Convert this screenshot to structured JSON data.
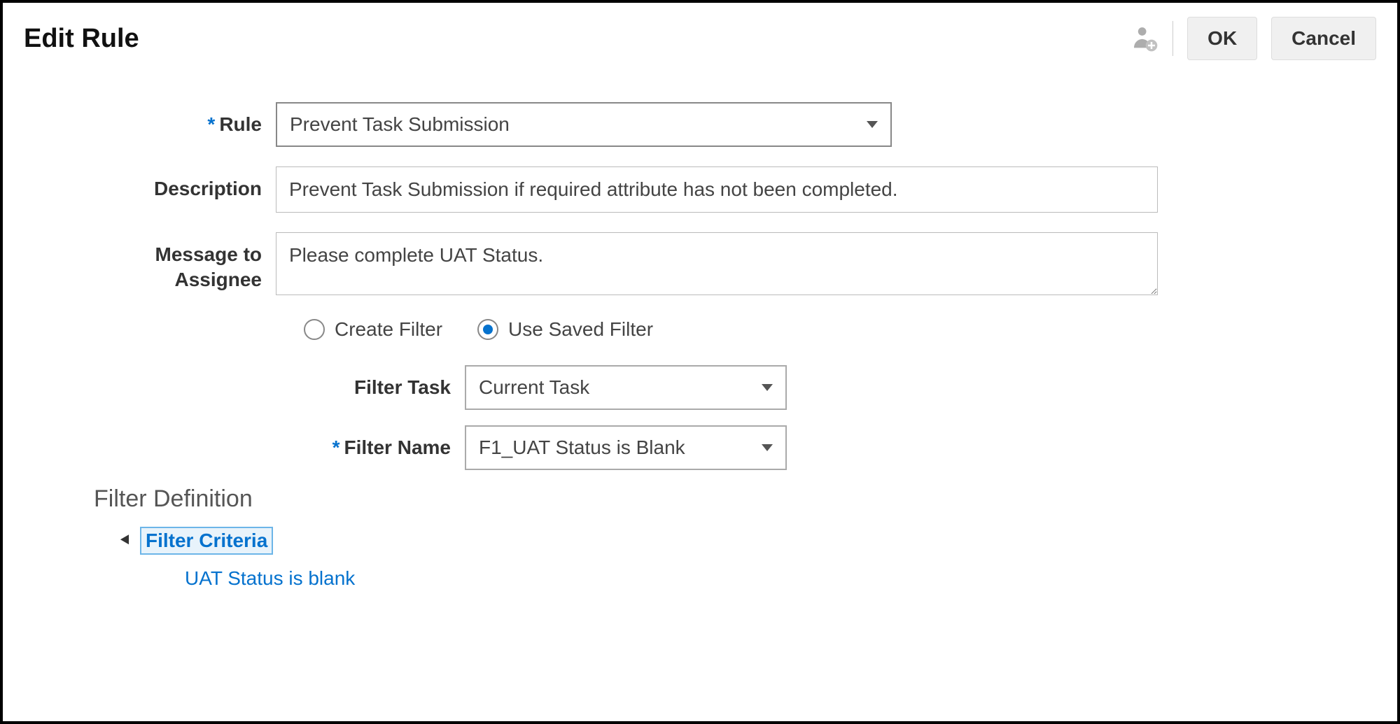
{
  "header": {
    "title": "Edit Rule",
    "ok": "OK",
    "cancel": "Cancel"
  },
  "form": {
    "rule_label": "Rule",
    "rule_value": "Prevent Task Submission",
    "description_label": "Description",
    "description_value": "Prevent Task Submission if required attribute has not been completed.",
    "message_label": "Message to Assignee",
    "message_value": "Please complete UAT Status."
  },
  "filter_mode": {
    "create_label": "Create Filter",
    "saved_label": "Use Saved Filter",
    "selected": "saved"
  },
  "subform": {
    "filter_task_label": "Filter Task",
    "filter_task_value": "Current Task",
    "filter_name_label": "Filter Name",
    "filter_name_value": "F1_UAT Status is Blank"
  },
  "filter_def": {
    "section_title": "Filter Definition",
    "criteria_label": "Filter Criteria",
    "criteria_items": [
      "UAT Status is blank"
    ]
  }
}
